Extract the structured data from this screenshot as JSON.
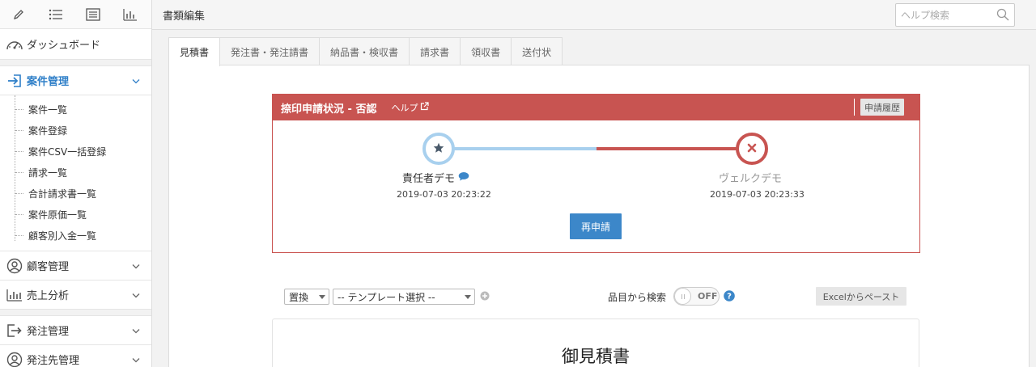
{
  "sidebar": {
    "top_icons": [
      "pencil-icon",
      "list-icon",
      "checklist-icon",
      "bar-chart-icon"
    ],
    "dashboard": "ダッシュボード",
    "project": {
      "label": "案件管理",
      "items": [
        "案件一覧",
        "案件登録",
        "案件CSV一括登録",
        "請求一覧",
        "合計請求書一覧",
        "案件原価一覧",
        "顧客別入金一覧"
      ]
    },
    "customer": "顧客管理",
    "sales": "売上分析",
    "order": "発注管理",
    "supplier": "発注先管理"
  },
  "topbar": {
    "title": "書類編集",
    "search_placeholder": "ヘルプ検索"
  },
  "tabs": [
    "見積書",
    "発注書・発注請書",
    "納品書・検収書",
    "請求書",
    "領収書",
    "送付状"
  ],
  "approval": {
    "title": "捺印申請状況 - 否認",
    "help": "ヘルプ",
    "history_button": "申請履歴",
    "steps": [
      {
        "name": "責任者デモ",
        "date": "2019-07-03 20:23:22",
        "status": "approved"
      },
      {
        "name": "ヴェルクデモ",
        "date": "2019-07-03 20:23:33",
        "status": "rejected"
      }
    ],
    "reapply_button": "再申請"
  },
  "toolbar": {
    "replace_select": "置換",
    "template_select": "-- テンプレート選択 --",
    "item_search_label": "品目から検索",
    "toggle_state": "OFF",
    "excel_paste_button": "Excelからペースト"
  },
  "document": {
    "title": "御見積書"
  },
  "colors": {
    "accent": "#2f7fc8",
    "reject": "#c85451",
    "approve_line": "#a8d0ee",
    "button": "#3c87c9"
  }
}
